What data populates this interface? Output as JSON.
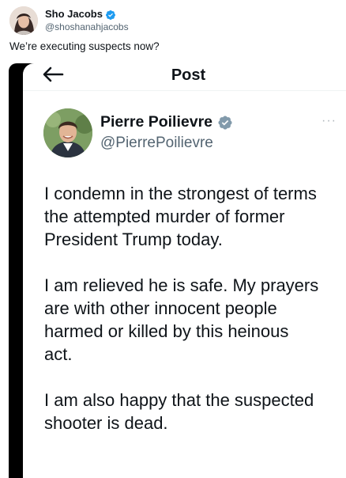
{
  "outer_tweet": {
    "author_name": "Sho Jacobs",
    "author_handle": "@shoshanahjacobs",
    "text": "We’re executing suspects now?"
  },
  "embedded_post": {
    "header_title": "Post",
    "author_name": "Pierre Poilievre",
    "author_handle": "@PierrePoilievre",
    "more_label": "···",
    "paragraphs": [
      "I condemn in the strongest of terms\nthe attempted murder of former\nPresident Trump today.",
      "I am relieved he is safe. My prayers\nare with other innocent people\nharmed or killed by this heinous\nact.",
      "I am also happy that the suspected\nshooter is dead."
    ]
  },
  "colors": {
    "verified_blue": "#1d9bf0",
    "verified_gray": "#829aab",
    "text_primary": "#0f1419",
    "text_secondary": "#536471",
    "embed_frame": "#000000"
  },
  "icons": {
    "verified": "verified-badge-icon",
    "back": "back-arrow-icon",
    "more": "more-options-icon"
  }
}
